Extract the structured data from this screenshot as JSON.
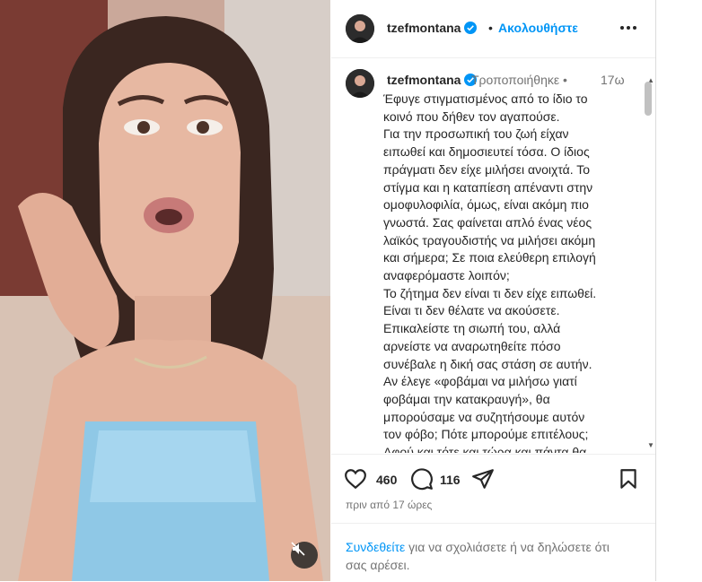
{
  "post": {
    "username": "tzefmontana",
    "separator": "•",
    "follow_label": "Ακολουθήστε",
    "more_icon": "more-horizontal-icon"
  },
  "caption": {
    "username": "tzefmontana",
    "edited_label": "Τροποποιήθηκε",
    "separator": "•",
    "time": "17ω",
    "text": "Έφυγε στιγματισμένος από το ίδιο το\nκοινό που δήθεν τον αγαπούσε.\nΓια την προσωπική του ζωή είχαν\nειπωθεί και δημοσιευτεί τόσα. Ο ίδιος\nπράγματι δεν είχε μιλήσει ανοιχτά. Το\nστίγμα και η καταπίεση απέναντι στην\nομοφυλοφιλία, όμως, είναι ακόμη πιο\nγνωστά. Σας φαίνεται απλό ένας νέος\nλαϊκός τραγουδιστής να μιλήσει ακόμη\nκαι σήμερα; Σε ποια ελεύθερη επιλογή\nαναφερόμαστε λοιπόν;\nΤο ζήτημα δεν είναι τι δεν είχε ειπωθεί.\nΕίναι τι δεν θέλατε να ακούσετε.\nΕπικαλείστε τη σιωπή του, αλλά\nαρνείστε να αναρωτηθείτε πόσο\nσυνέβαλε η δική σας στάση σε αυτήν.\nΑν έλεγε «φοβάμαι να μιλήσω γιατί\nφοβάμαι την κατακραυγή», θα\nμπορούσαμε να συζητήσουμε αυτόν\nτον φόβο; Πότε μπορούμε επιτέλους;\nΑφού και τότε και τώρα και πάντα θα"
  },
  "actions": {
    "like_count": "460",
    "comment_count": "116"
  },
  "timeago": "πριν από 17 ώρες",
  "login_prompt": {
    "link": "Συνδεθείτε",
    "text": " για να σχολιάσετε ή να δηλώσετε ότι σας αρέσει."
  },
  "colors": {
    "accent": "#0095f6",
    "text": "#262626",
    "muted": "#737373"
  }
}
